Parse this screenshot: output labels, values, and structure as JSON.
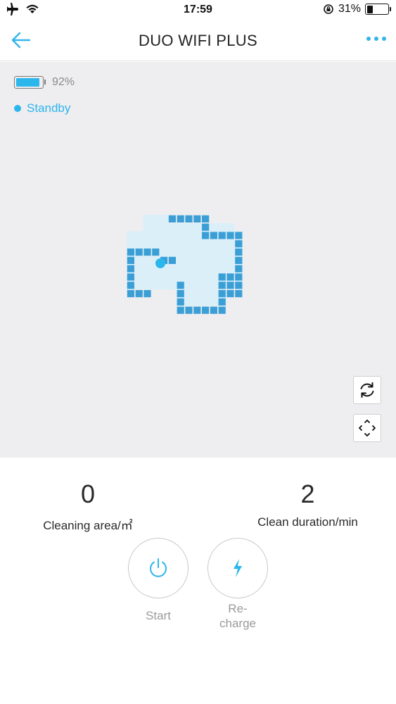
{
  "status_bar": {
    "time": "17:59",
    "battery_percent": "31%",
    "battery_level": 0.31,
    "icons": [
      "airplane-icon",
      "wifi-icon",
      "orientation-lock-icon",
      "battery-icon"
    ]
  },
  "nav": {
    "title": "DUO WIFI PLUS",
    "back_icon": "arrow-left-icon",
    "more_icon": "more-dots-icon",
    "accent": "#33b5e8"
  },
  "robot": {
    "battery_percent": "92%",
    "battery_level": 0.92,
    "state": "Standby",
    "accent": "#2bb6ec"
  },
  "map": {
    "controls": [
      "refresh-icon",
      "fit-view-icon"
    ],
    "wall_color": "#3b9fd6",
    "floor_color": "#dbeff9",
    "robot_color": "#2bb6ec"
  },
  "stats": {
    "area_value": "0",
    "area_label": "Cleaning area/㎡",
    "duration_value": "2",
    "duration_label": "Clean duration/min"
  },
  "actions": {
    "start_label": "Start",
    "recharge_label": "Re-\ncharge"
  }
}
